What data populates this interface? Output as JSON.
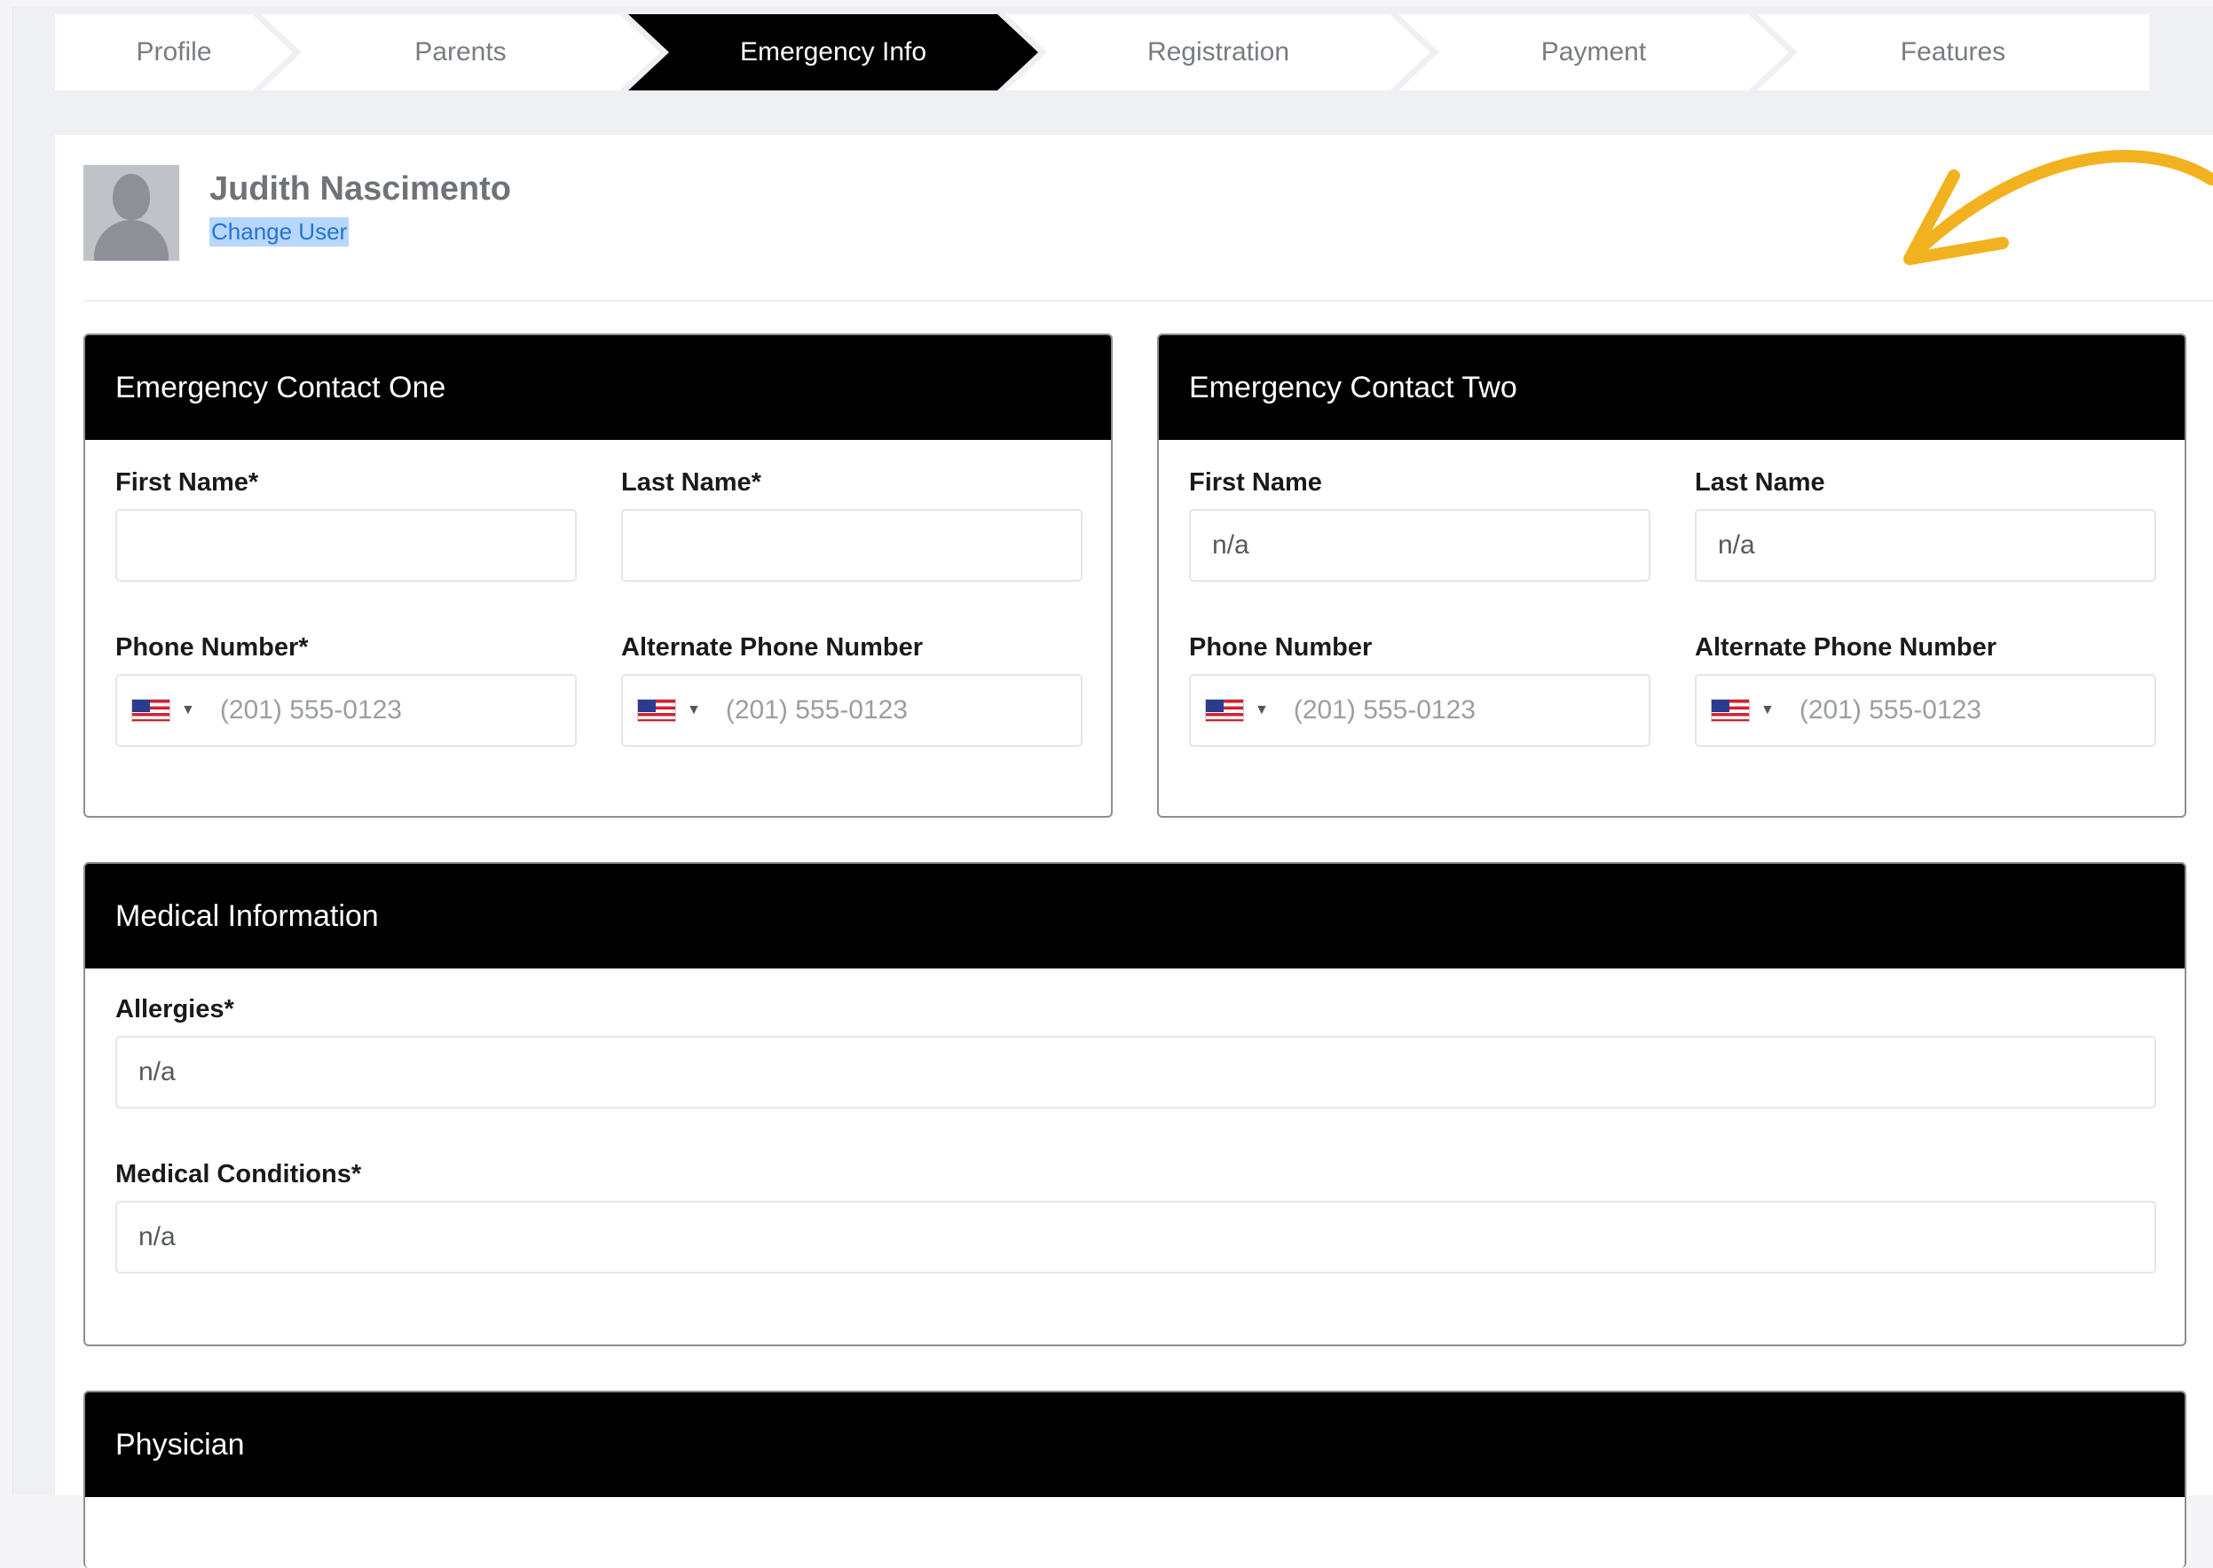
{
  "steps": [
    "Profile",
    "Parents",
    "Emergency Info",
    "Registration",
    "Payment",
    "Features"
  ],
  "active_step": "Emergency Info",
  "user": {
    "name": "Judith Nascimento",
    "change_label": "Change User"
  },
  "contact_one": {
    "title": "Emergency Contact One",
    "first_name_label": "First Name*",
    "last_name_label": "Last Name*",
    "first_name_value": "",
    "last_name_value": "",
    "phone_label": "Phone Number*",
    "alt_phone_label": "Alternate Phone Number",
    "phone_placeholder": "(201) 555-0123",
    "alt_phone_placeholder": "(201) 555-0123"
  },
  "contact_two": {
    "title": "Emergency Contact Two",
    "first_name_label": "First Name",
    "last_name_label": "Last Name",
    "first_name_value": "n/a",
    "last_name_value": "n/a",
    "phone_label": "Phone Number",
    "alt_phone_label": "Alternate Phone Number",
    "phone_placeholder": "(201) 555-0123",
    "alt_phone_placeholder": "(201) 555-0123"
  },
  "medical": {
    "title": "Medical Information",
    "allergies_label": "Allergies*",
    "allergies_value": "n/a",
    "conditions_label": "Medical Conditions*",
    "conditions_value": "n/a"
  },
  "physician": {
    "title": "Physician"
  },
  "colors": {
    "active_step_bg": "#000000",
    "accent_arrow": "#f2b21f",
    "link": "#2573d9"
  }
}
